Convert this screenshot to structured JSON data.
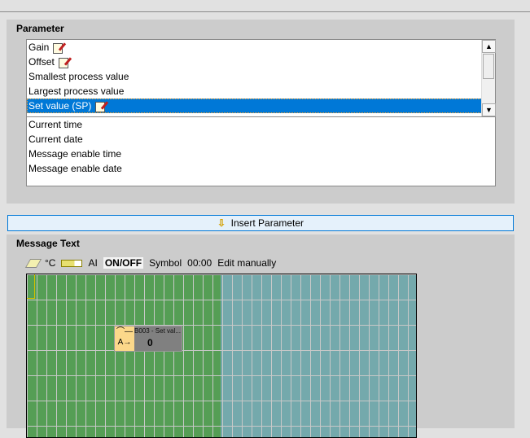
{
  "parameter": {
    "title": "Parameter",
    "items": [
      {
        "label": "Gain",
        "editable": true
      },
      {
        "label": "Offset",
        "editable": true
      },
      {
        "label": "Smallest process value",
        "editable": false
      },
      {
        "label": "Largest process value",
        "editable": false
      },
      {
        "label": "Set value (SP)",
        "editable": true,
        "selected": true
      }
    ],
    "items2": [
      "Current time",
      "Current date",
      "Message enable time",
      "Message enable date"
    ]
  },
  "insert_button": "Insert Parameter",
  "message": {
    "title": "Message Text",
    "toolbar": {
      "unit": "°C",
      "ai": "AI",
      "onoff": "ON/OFF",
      "symbol": "Symbol",
      "time": "00:00",
      "edit": "Edit manually"
    },
    "tag": {
      "label": "B003 - Set val...",
      "value": "0",
      "icon_top": "⌒—",
      "icon_bottom": "A→"
    }
  },
  "colors": {
    "selection": "#0078d7",
    "green": "#559e55",
    "teal": "#74a9ac"
  }
}
